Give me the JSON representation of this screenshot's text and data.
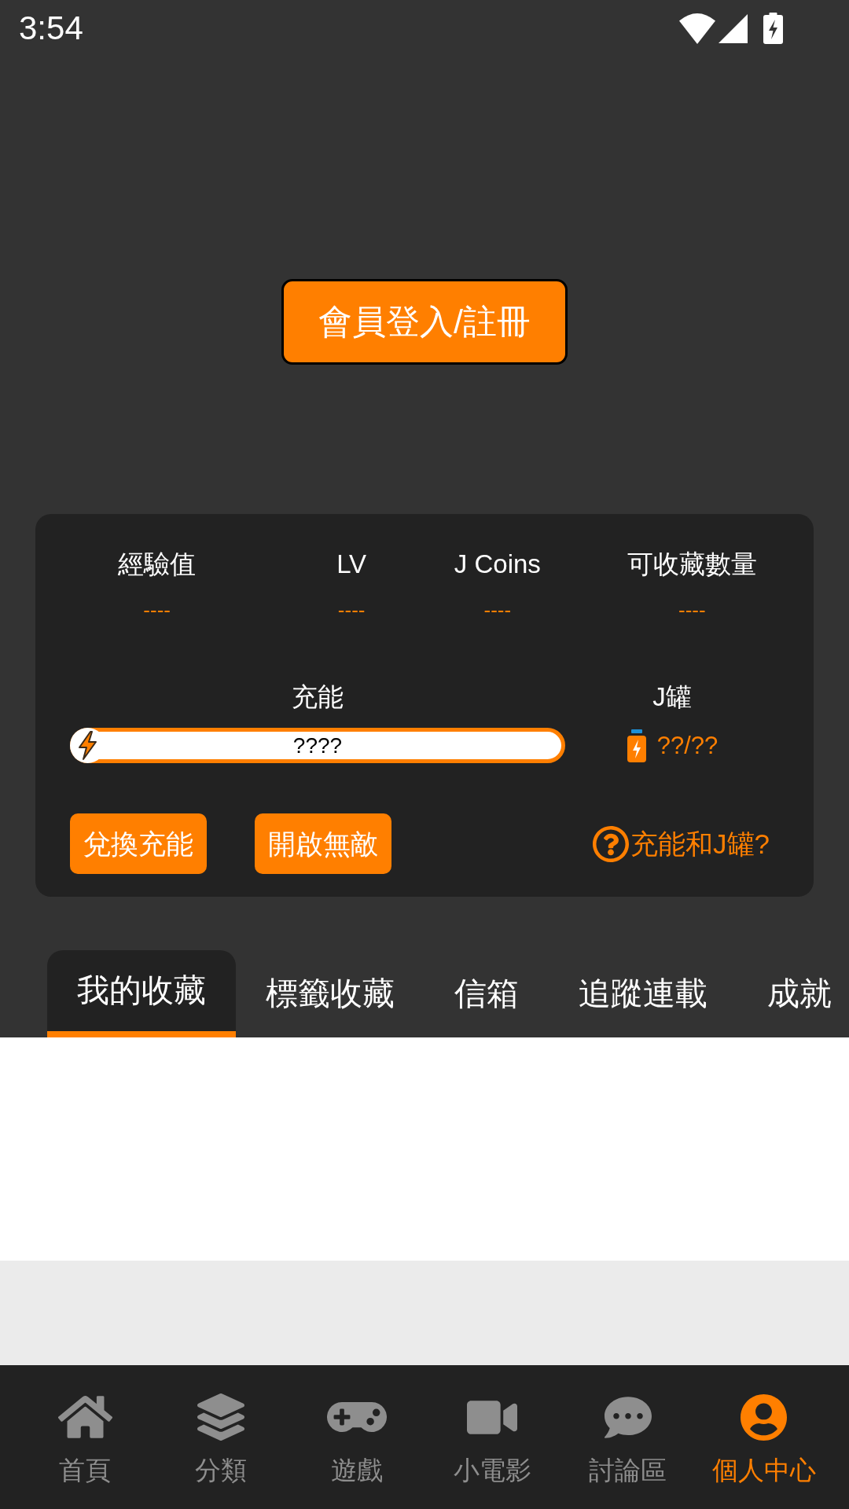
{
  "status_bar": {
    "time": "3:54"
  },
  "login_button": {
    "label": "會員登入/註冊"
  },
  "stats": [
    {
      "label": "經驗值",
      "value": "----"
    },
    {
      "label": "LV",
      "value": "----"
    },
    {
      "label": "J Coins",
      "value": "----"
    },
    {
      "label": "可收藏數量",
      "value": "----"
    }
  ],
  "charge": {
    "label": "充能",
    "reading": "????"
  },
  "jar": {
    "label": "J罐",
    "value": "??/??"
  },
  "actions": [
    {
      "label": "兌換充能"
    },
    {
      "label": "開啟無敵"
    }
  ],
  "help_link": {
    "label": "充能和J罐?"
  },
  "tabs": [
    {
      "label": "我的收藏",
      "selected": true
    },
    {
      "label": "標籤收藏",
      "selected": false
    },
    {
      "label": "信箱",
      "selected": false
    },
    {
      "label": "追蹤連載",
      "selected": false
    },
    {
      "label": "成就",
      "selected": false
    }
  ],
  "bottom_nav": [
    {
      "label": "首頁",
      "selected": false
    },
    {
      "label": "分類",
      "selected": false
    },
    {
      "label": "遊戲",
      "selected": false
    },
    {
      "label": "小電影",
      "selected": false
    },
    {
      "label": "討論區",
      "selected": false
    },
    {
      "label": "個人中心",
      "selected": true
    }
  ]
}
